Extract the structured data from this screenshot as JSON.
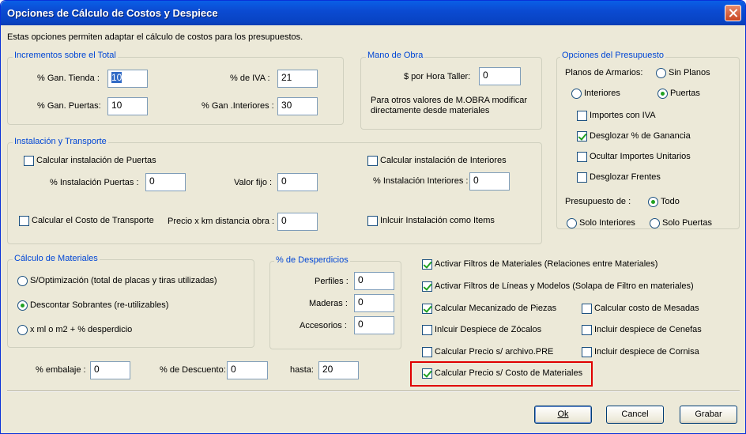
{
  "window": {
    "title": "Opciones de Cálculo de Costos y Despiece"
  },
  "description": "Estas opciones permiten adaptar el cálculo de costos para los presupuestos.",
  "incrementos": {
    "title": "Incrementos sobre el Total",
    "gan_tienda_label": "% Gan. Tienda :",
    "gan_tienda_value": "10",
    "iva_label": "% de IVA :",
    "iva_value": "21",
    "gan_puertas_label": "% Gan. Puertas:",
    "gan_puertas_value": "10",
    "gan_interiores_label": "% Gan .Interiores :",
    "gan_interiores_value": "30"
  },
  "mano_obra": {
    "title": "Mano de Obra",
    "hora_label": "$ por Hora Taller:",
    "hora_value": "0",
    "note_line1": "Para otros valores de M.OBRA modificar",
    "note_line2": "directamente desde materiales"
  },
  "opciones_presupuesto": {
    "title": "Opciones del Presupuesto",
    "planos_label": "Planos de Armarios:",
    "sin_planos": "Sin Planos",
    "interiores": "Interiores",
    "puertas": "Puertas",
    "importes_iva": "Importes con IVA",
    "desglozar_ganancia": "Desglozar % de Ganancia",
    "ocultar_unitarios": "Ocultar Importes Unitarios",
    "desglozar_frentes": "Desglozar Frentes",
    "presupuesto_de_label": "Presupuesto de :",
    "todo": "Todo",
    "solo_interiores": "Solo Interiores",
    "solo_puertas": "Solo Puertas"
  },
  "instalacion": {
    "title": "Instalación y Transporte",
    "calc_puertas": "Calcular instalación de Puertas",
    "calc_interiores": "Calcular instalación de Interiores",
    "inst_puertas_label": "% Instalación Puertas :",
    "inst_puertas_value": "0",
    "valor_fijo_label": "Valor fijo :",
    "valor_fijo_value": "0",
    "inst_interiores_label": "% Instalación Interiores :",
    "inst_interiores_value": "0",
    "calc_transporte": "Calcular el Costo de Transporte",
    "precio_km_label": "Precio x km distancia obra :",
    "precio_km_value": "0",
    "incluir_items": "Inlcuir Instalación como Items"
  },
  "calculo_materiales": {
    "title": "Cálculo de Materiales",
    "optimizacion": "S/Optimización (total de placas y tiras utilizadas)",
    "descontar": "Descontar Sobrantes (re-utilizables)",
    "ml_m2": "x ml o m2 + % desperdicio"
  },
  "desperdicios": {
    "title": "% de Desperdicios",
    "perfiles_label": "Perfiles :",
    "perfiles_value": "0",
    "maderas_label": "Maderas :",
    "maderas_value": "0",
    "accesorios_label": "Accesorios :",
    "accesorios_value": "0"
  },
  "filtros": {
    "activar_materiales": "Activar Filtros de Materiales (Relaciones entre Materiales)",
    "activar_lineas": "Activar Filtros de Líneas y Modelos (Solapa de Filtro en materiales)",
    "mecanizado": "Calcular Mecanizado de Piezas",
    "mesadas": "Calcular costo de Mesadas",
    "zocalos": "Inlcuir Despiece de Zócalos",
    "cenefas": "Incluir despiece de Cenefas",
    "archivo_pre": "Calcular Precio s/ archivo.PRE",
    "cornisa": "Incluir despiece de Cornisa",
    "costo_materiales": "Calcular Precio s/ Costo de Materiales"
  },
  "bottom": {
    "embalaje_label": "% embalaje :",
    "embalaje_value": "0",
    "descuento_label": "% de Descuento:",
    "descuento_value": "0",
    "hasta_label": "hasta:",
    "hasta_value": "20"
  },
  "buttons": {
    "ok": "Ok",
    "cancel": "Cancel",
    "grabar": "Grabar"
  },
  "colors": {
    "titlebar": "#0b4bd2",
    "group_title": "#0046d5",
    "highlight": "#e00000"
  }
}
